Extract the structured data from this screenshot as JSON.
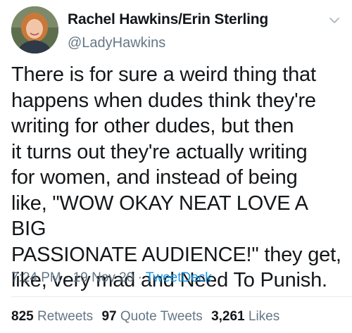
{
  "user": {
    "display_name": "Rachel Hawkins/Erin Sterling",
    "handle": "@LadyHawkins",
    "avatar_icon": "profile-photo"
  },
  "tweet": {
    "text": "There is for sure a weird thing that\nhappens when dudes think they're\nwriting for other dudes, but then\nit turns out they're actually writing\nfor women, and instead of being\nlike, \"WOW OKAY NEAT LOVE A BIG\nPASSIONATE AUDIENCE!\" they get,\nlike, very mad and Need To Punish.",
    "time": "7:24 PM",
    "separator": "·",
    "date": "19 Nov 20",
    "source": "TweetDeck"
  },
  "stats": {
    "retweets_count": "825",
    "retweets_label": "Retweets",
    "quotes_count": "97",
    "quotes_label": "Quote Tweets",
    "likes_count": "3,261",
    "likes_label": "Likes"
  },
  "colors": {
    "text": "#14171a",
    "secondary": "#657786",
    "link": "#1b95e0",
    "divider": "#e6ecf0"
  }
}
